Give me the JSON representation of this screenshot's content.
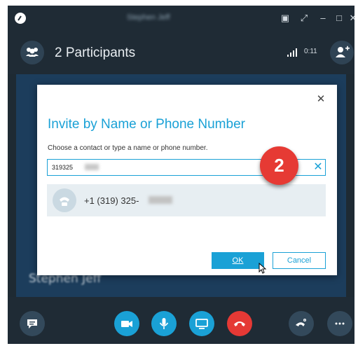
{
  "titlebar": {
    "title": "Stephen Jeff",
    "icons": [
      "skype-icon",
      "compact-view-icon",
      "expand-icon",
      "minimize-icon",
      "maximize-icon",
      "close-icon"
    ]
  },
  "header": {
    "participants_label": "2 Participants",
    "call_timer": "0:11"
  },
  "stage": {
    "caller_name": "Stephen Jeff"
  },
  "dialog": {
    "title": "Invite by Name or Phone Number",
    "instruction": "Choose a contact or type a name or phone number.",
    "input_value": "319325",
    "suggestion_number": "+1 (319) 325-",
    "ok_label": "OK",
    "cancel_label": "Cancel"
  },
  "step_badge": "2",
  "colors": {
    "accent": "#1aa1d6",
    "hangup": "#e53935",
    "badge": "#e63a34",
    "window_bg": "#1f2b35",
    "stage_bg": "#1c3d5c"
  },
  "toolbar": {
    "icons": [
      "chat-icon",
      "video-icon",
      "microphone-icon",
      "screen-share-icon",
      "hangup-icon",
      "dialpad-icon",
      "more-icon"
    ]
  }
}
